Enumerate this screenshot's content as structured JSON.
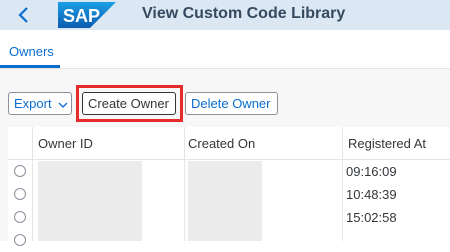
{
  "header": {
    "title": "View Custom Code Library",
    "logo_text": "SAP"
  },
  "tabs": [
    {
      "label": "Owners"
    }
  ],
  "toolbar": {
    "export_label": "Export",
    "create_label": "Create Owner",
    "delete_label": "Delete Owner"
  },
  "table": {
    "columns": [
      "Owner ID",
      "Created On",
      "Registered At"
    ],
    "rows": [
      {
        "registered_at": "09:16:09"
      },
      {
        "registered_at": "10:48:39"
      },
      {
        "registered_at": "15:02:58"
      }
    ]
  },
  "colors": {
    "accent": "#0a6ed1",
    "shell": "#dbe7f3",
    "highlight": "#e52b2b"
  }
}
